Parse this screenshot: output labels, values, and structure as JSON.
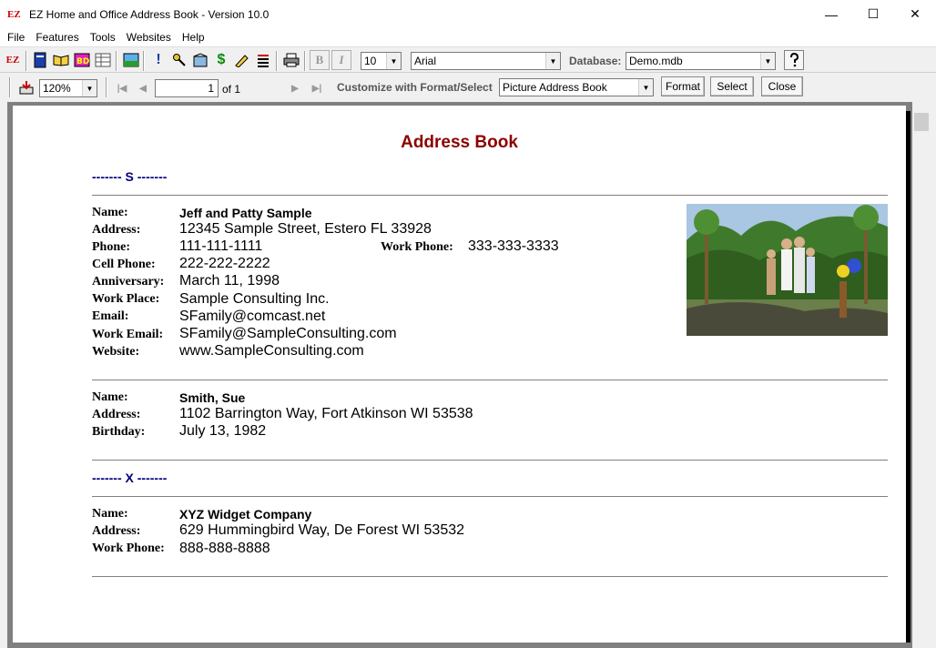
{
  "window": {
    "title": "EZ Home and Office Address Book - Version 10.0",
    "app_icon": "EZ"
  },
  "menu": [
    "File",
    "Features",
    "Tools",
    "Websites",
    "Help"
  ],
  "toolbar1": {
    "font_size": "10",
    "font_name": "Arial",
    "database_label": "Database:",
    "database_value": "Demo.mdb"
  },
  "toolbar2": {
    "zoom": "120%",
    "page": "1",
    "of_pages": "of 1",
    "customize_label": "Customize with Format/Select",
    "report_type": "Picture Address Book",
    "format_label": "Format",
    "select_label": "Select",
    "close_label": "Close"
  },
  "document": {
    "title": "Address Book",
    "section_s": "------- S -------",
    "section_x": "------- X -------",
    "labels": {
      "name": "Name:",
      "address": "Address:",
      "phone": "Phone:",
      "cell_phone": "Cell Phone:",
      "anniversary": "Anniversary:",
      "work_place": "Work Place:",
      "email": "Email:",
      "work_email": "Work Email:",
      "website": "Website:",
      "birthday": "Birthday:",
      "work_phone": "Work Phone:"
    },
    "entry1": {
      "name": "Jeff and Patty Sample",
      "address": "12345 Sample Street, Estero FL 33928",
      "phone": "111-111-1111",
      "work_phone": "333-333-3333",
      "cell_phone": "222-222-2222",
      "anniversary": "March 11, 1998",
      "work_place": "Sample Consulting Inc.",
      "email": "SFamily@comcast.net",
      "work_email": "SFamily@SampleConsulting.com",
      "website": "www.SampleConsulting.com"
    },
    "entry2": {
      "name": "Smith, Sue",
      "address": "1102 Barrington Way, Fort Atkinson WI 53538",
      "birthday": "July 13, 1982"
    },
    "entry3": {
      "name": "XYZ Widget Company",
      "address": "629 Hummingbird Way, De Forest WI 53532",
      "work_phone": "888-888-8888"
    }
  }
}
